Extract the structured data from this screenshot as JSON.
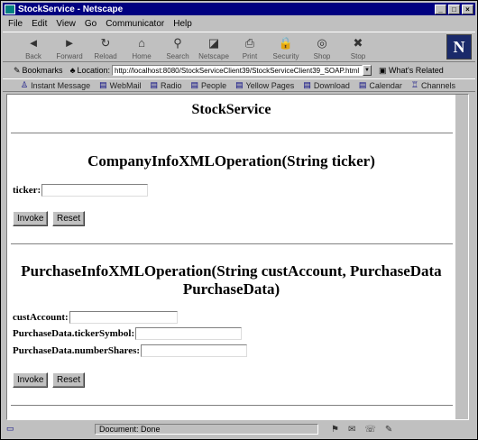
{
  "window": {
    "title": "StockService - Netscape",
    "controls": [
      "_",
      "□",
      "×"
    ]
  },
  "menu": [
    "File",
    "Edit",
    "View",
    "Go",
    "Communicator",
    "Help"
  ],
  "toolbar": [
    {
      "label": "Back",
      "icon": "back-icon",
      "glyph": "◄"
    },
    {
      "label": "Forward",
      "icon": "forward-icon",
      "glyph": "►"
    },
    {
      "label": "Reload",
      "icon": "reload-icon",
      "glyph": "↻"
    },
    {
      "label": "Home",
      "icon": "home-icon",
      "glyph": "⌂"
    },
    {
      "label": "Search",
      "icon": "search-icon",
      "glyph": "⚲"
    },
    {
      "label": "Netscape",
      "icon": "netscape-icon",
      "glyph": "◪"
    },
    {
      "label": "Print",
      "icon": "print-icon",
      "glyph": "⎙"
    },
    {
      "label": "Security",
      "icon": "lock-icon",
      "glyph": "🔒"
    },
    {
      "label": "Shop",
      "icon": "shop-icon",
      "glyph": "◎"
    },
    {
      "label": "Stop",
      "icon": "stop-icon",
      "glyph": "✖"
    }
  ],
  "location": {
    "bookmarks_label": "Bookmarks",
    "location_label": "Location:",
    "url": "http://localhost:8080/StockServiceClient39/StockServiceClient39_SOAP.html",
    "whats_related": "What's Related"
  },
  "personal": [
    {
      "label": "Instant Message",
      "icon": "person-icon"
    },
    {
      "label": "WebMail",
      "icon": "bookmark-icon"
    },
    {
      "label": "Radio",
      "icon": "bookmark-icon"
    },
    {
      "label": "People",
      "icon": "bookmark-icon"
    },
    {
      "label": "Yellow Pages",
      "icon": "bookmark-icon"
    },
    {
      "label": "Download",
      "icon": "bookmark-icon"
    },
    {
      "label": "Calendar",
      "icon": "bookmark-icon"
    },
    {
      "label": "Channels",
      "icon": "channels-icon"
    }
  ],
  "page": {
    "title": "StockService",
    "op1": {
      "heading": "CompanyInfoXMLOperation(String ticker)",
      "field_label": "ticker:",
      "field_value": "",
      "invoke_label": "Invoke",
      "reset_label": "Reset"
    },
    "op2": {
      "heading_line1": "PurchaseInfoXMLOperation(String custAccount, PurchaseData",
      "heading_line2": "PurchaseData)",
      "fields": [
        {
          "label": "custAccount:",
          "value": ""
        },
        {
          "label": "PurchaseData.tickerSymbol:",
          "value": ""
        },
        {
          "label": "PurchaseData.numberShares:",
          "value": ""
        }
      ],
      "invoke_label": "Invoke",
      "reset_label": "Reset"
    }
  },
  "status": {
    "text": "Document: Done"
  }
}
